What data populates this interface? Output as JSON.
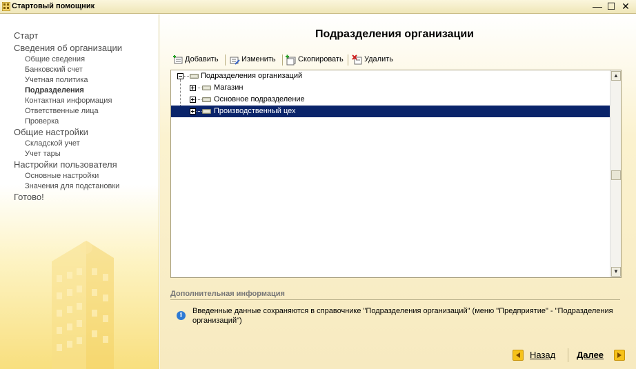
{
  "window": {
    "title": "Стартовый помощник",
    "controls": {
      "minimize": "—",
      "maximize": "☐",
      "close": "✕"
    }
  },
  "nav": {
    "items": [
      {
        "label": "Старт",
        "level": 1
      },
      {
        "label": "Сведения об организации",
        "level": 1
      },
      {
        "label": "Общие сведения",
        "level": 2
      },
      {
        "label": "Банковский счет",
        "level": 2
      },
      {
        "label": "Учетная политика",
        "level": 2
      },
      {
        "label": "Подразделения",
        "level": 2,
        "active": true
      },
      {
        "label": "Контактная информация",
        "level": 2
      },
      {
        "label": "Ответственные лица",
        "level": 2
      },
      {
        "label": "Проверка",
        "level": 2
      },
      {
        "label": "Общие настройки",
        "level": 1
      },
      {
        "label": "Складской учет",
        "level": 2
      },
      {
        "label": "Учет тары",
        "level": 2
      },
      {
        "label": "Настройки пользователя",
        "level": 1
      },
      {
        "label": "Основные настройки",
        "level": 2
      },
      {
        "label": "Значения для подстановки",
        "level": 2
      },
      {
        "label": "Готово!",
        "level": 1
      }
    ]
  },
  "main": {
    "title": "Подразделения организации",
    "toolbar": {
      "add": "Добавить",
      "edit": "Изменить",
      "copy": "Скопировать",
      "delete": "Удалить"
    },
    "tree": {
      "root": "Подразделения организаций",
      "children": [
        {
          "label": "Магазин",
          "selected": false
        },
        {
          "label": "Основное подразделение",
          "selected": false
        },
        {
          "label": "Производственный цех",
          "selected": true
        }
      ]
    },
    "info": {
      "header": "Дополнительная информация",
      "text": "Введенные данные сохраняются в справочнике \"Подразделения организаций\" (меню \"Предприятие\" - \"Подразделения организаций\")"
    },
    "buttons": {
      "back": "Назад",
      "next": "Далее"
    }
  },
  "colors": {
    "selection": "#0a246a",
    "accent_arrow": "#f6c21a",
    "info_icon": "#2e7ad4"
  }
}
